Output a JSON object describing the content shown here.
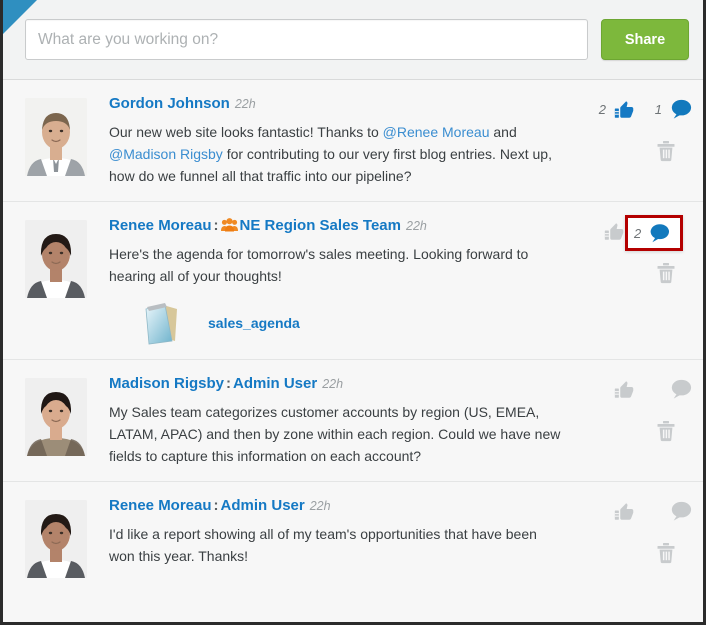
{
  "composer": {
    "placeholder": "What are you working on?",
    "value": "",
    "share_label": "Share"
  },
  "colors": {
    "accent_blue": "#1579c4",
    "mention_blue": "#3a8dd0",
    "share_green": "#7db83c",
    "highlight_red": "#b40000",
    "icon_gray": "#c8cbcd",
    "corner_flag": "#2f8fc0"
  },
  "posts": [
    {
      "author": "Gordon Johnson",
      "separator": "",
      "target": "",
      "group_icon": "",
      "timestamp": "22h",
      "text_parts": [
        {
          "type": "text",
          "value": "Our new web site looks fantastic!  Thanks to "
        },
        {
          "type": "mention",
          "value": "@Renee Moreau"
        },
        {
          "type": "text",
          "value": " and "
        },
        {
          "type": "mention",
          "value": "@Madison Rigsby"
        },
        {
          "type": "text",
          "value": " for contributing to our very first blog entries.  Next up, how do we funnel all that traffic into our pipeline?"
        }
      ],
      "avatar": "photo-male-1",
      "like_count": "2",
      "like_active": true,
      "comment_count": "1",
      "comment_active": true,
      "comment_highlighted": false,
      "attachment": null
    },
    {
      "author": "Renee Moreau",
      "separator": ":",
      "target": "NE Region Sales Team",
      "group_icon": "group-icon",
      "timestamp": "22h",
      "text_parts": [
        {
          "type": "text",
          "value": "Here's the agenda for tomorrow's sales meeting.  Looking forward to hearing all of your thoughts!"
        }
      ],
      "avatar": "photo-female-1",
      "like_count": "",
      "like_active": false,
      "comment_count": "2",
      "comment_active": true,
      "comment_highlighted": true,
      "attachment": {
        "name": "sales_agenda",
        "icon": "notepad-file-icon"
      }
    },
    {
      "author": "Madison Rigsby",
      "separator": ":",
      "target": "Admin User",
      "group_icon": "",
      "timestamp": "22h",
      "text_parts": [
        {
          "type": "text",
          "value": "My Sales team categorizes customer accounts by region (US, EMEA, LATAM, APAC) and then by zone within each region. Could we have new fields to capture this information on each account?"
        }
      ],
      "avatar": "photo-female-2",
      "like_count": "",
      "like_active": false,
      "comment_count": "",
      "comment_active": false,
      "comment_highlighted": false,
      "attachment": null
    },
    {
      "author": "Renee Moreau",
      "separator": ":",
      "target": "Admin User",
      "group_icon": "",
      "timestamp": "22h",
      "text_parts": [
        {
          "type": "text",
          "value": "I'd like a report showing all of my team's opportunities that have been won this year.  Thanks!"
        }
      ],
      "avatar": "photo-female-1",
      "like_count": "",
      "like_active": false,
      "comment_count": "",
      "comment_active": false,
      "comment_highlighted": false,
      "attachment": null
    }
  ]
}
